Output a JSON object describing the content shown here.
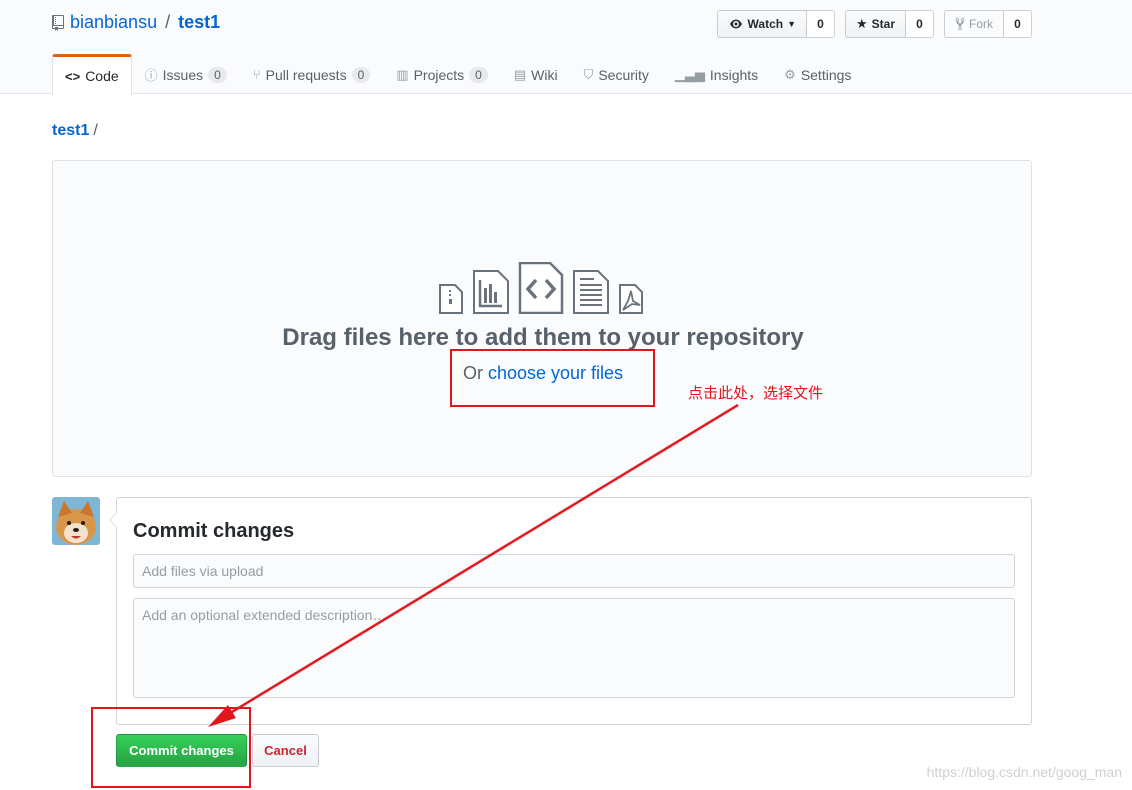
{
  "header": {
    "owner": "bianbiansu",
    "separator": "/",
    "repo": "test1",
    "actions": {
      "watch_label": "Watch",
      "watch_count": "0",
      "star_label": "Star",
      "star_count": "0",
      "fork_label": "Fork",
      "fork_count": "0"
    }
  },
  "nav": {
    "tabs": [
      {
        "label": "Code",
        "icon": "code-icon",
        "count": null,
        "selected": true
      },
      {
        "label": "Issues",
        "icon": "issue-icon",
        "count": "0"
      },
      {
        "label": "Pull requests",
        "icon": "pull-request-icon",
        "count": "0"
      },
      {
        "label": "Projects",
        "icon": "project-icon",
        "count": "0"
      },
      {
        "label": "Wiki",
        "icon": "book-icon",
        "count": null
      },
      {
        "label": "Security",
        "icon": "shield-icon",
        "count": null
      },
      {
        "label": "Insights",
        "icon": "graph-icon",
        "count": null
      },
      {
        "label": "Settings",
        "icon": "gear-icon",
        "count": null
      }
    ]
  },
  "breadcrumb": {
    "repo": "test1",
    "slash": "/"
  },
  "dropzone": {
    "title": "Drag files here to add them to your repository",
    "or_text": "Or ",
    "choose_link": "choose your files"
  },
  "commit": {
    "heading": "Commit changes",
    "summary_placeholder": "Add files via upload",
    "description_placeholder": "Add an optional extended description…",
    "commit_button": "Commit changes",
    "cancel_button": "Cancel"
  },
  "annotation": {
    "text": "点击此处，选择文件",
    "color": "#e0161b"
  },
  "watermark": "https://blog.csdn.net/goog_man",
  "colors": {
    "link": "#0366d6",
    "primary_button": "#28a745",
    "danger": "#cb2431",
    "tab_accent": "#e36209"
  }
}
